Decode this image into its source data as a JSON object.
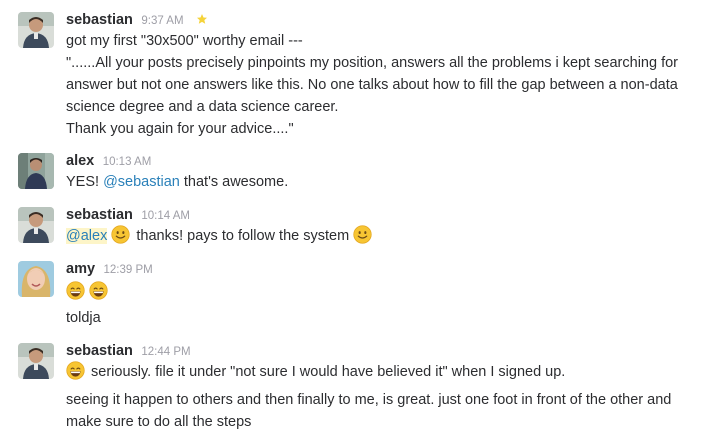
{
  "messages": [
    {
      "author": "sebastian",
      "time": "9:37 AM",
      "starred": true,
      "lines": [
        "got my first \"30x500\" worthy email ---",
        "\"......All your posts precisely pinpoints my position, answers all the problems i kept searching for",
        "answer but not one answers like this. No one talks about how to fill the gap between a non-data",
        "science degree and a data science career.",
        "Thank you again for your advice....\""
      ]
    },
    {
      "author": "alex",
      "time": "10:13 AM",
      "parts": {
        "before": "YES! ",
        "mention": "@sebastian",
        "after": " that's awesome."
      }
    },
    {
      "author": "sebastian",
      "time": "10:14 AM",
      "parts": {
        "mention": "@alex",
        "emoji1": "slightly-smiling-face",
        "text": " thanks! pays to follow the system ",
        "emoji2": "slightly-smiling-face"
      }
    },
    {
      "author": "amy",
      "time": "12:39 PM",
      "emojis": [
        "grinning-face",
        "grinning-face"
      ],
      "followup": "toldja"
    },
    {
      "author": "sebastian",
      "time": "12:44 PM",
      "emoji": "grinning-face",
      "text": " seriously. file it under \"not sure I would have believed it\" when I signed up.",
      "followup_lines": [
        "seeing it happen to others and then finally to me, is great. just one foot in front of the other and",
        "make sure to do all the steps"
      ]
    }
  ],
  "colors": {
    "mention": "#2a80b9",
    "mention_highlight": "#fdf5c8",
    "star": "#f5d33a",
    "timestamp": "#9e9ea6"
  }
}
